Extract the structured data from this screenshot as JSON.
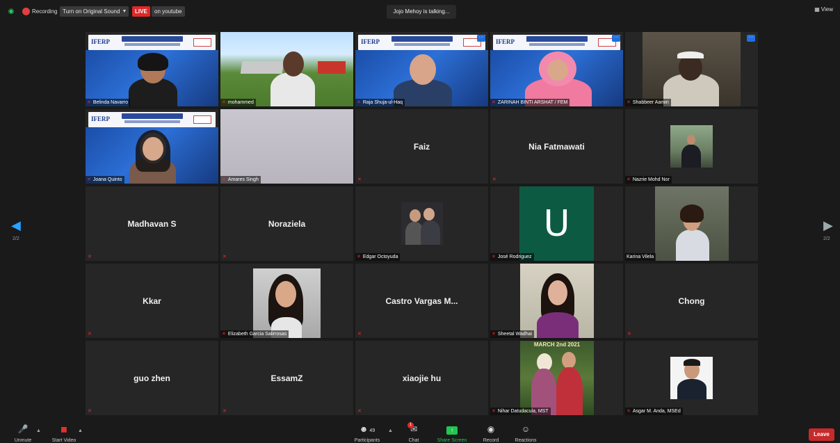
{
  "topbar": {
    "recording_label": "Recording",
    "sound_button": "Turn on Original Sound",
    "live_badge": "LIVE",
    "live_where": "on youtube",
    "talking": "Jojo Mehoy is talking...",
    "view_label": "View"
  },
  "banner": {
    "logo": "IFERP"
  },
  "tiles": [
    {
      "name": "Belinda Navarro",
      "kind": "video"
    },
    {
      "name": "mohammed",
      "kind": "video"
    },
    {
      "name": "Raja Shuja-ul-Haq",
      "kind": "video"
    },
    {
      "name": "ZARINAH BINTI ARSHAT / FEM",
      "kind": "video"
    },
    {
      "name": "Shabbeer Aamiri",
      "kind": "video"
    },
    {
      "name": "Joana Quinto",
      "kind": "video"
    },
    {
      "name": "Amares Singh",
      "kind": "video"
    },
    {
      "name": "Faiz",
      "kind": "name"
    },
    {
      "name": "Nia Fatmawati",
      "kind": "name"
    },
    {
      "name": "Nazrie Mohd Nor",
      "kind": "photo"
    },
    {
      "name": "Madhavan S",
      "kind": "name"
    },
    {
      "name": "Noraziela",
      "kind": "name"
    },
    {
      "name": "Edgar Octoyuda",
      "kind": "photo"
    },
    {
      "name": "José Rodriguez",
      "kind": "avatar",
      "avatar_letter": "U"
    },
    {
      "name": "Karina Vilela",
      "kind": "photo"
    },
    {
      "name": "Kkar",
      "kind": "name"
    },
    {
      "name": "Elizabeth Garcia Salirrosas",
      "kind": "photo"
    },
    {
      "name": "Castro Vargas M...",
      "kind": "name"
    },
    {
      "name": "Sheetal Wadhai",
      "kind": "photo"
    },
    {
      "name": "Chong",
      "kind": "name"
    },
    {
      "name": "guo zhen",
      "kind": "name"
    },
    {
      "name": "EssamZ",
      "kind": "name"
    },
    {
      "name": "xiaojie hu",
      "kind": "name"
    },
    {
      "name": "Nihar Datudacula, MST",
      "kind": "photo",
      "photo_caption": "MARCH 2nd 2021"
    },
    {
      "name": "Asgar M. Anda, MSEd",
      "kind": "photo"
    }
  ],
  "navigation": {
    "page_left": "2/2",
    "page_right": "2/2"
  },
  "controls": {
    "unmute": "Unmute",
    "start_video": "Start Video",
    "participants": "Participants",
    "participants_count": "49",
    "chat": "Chat",
    "chat_badge": "1",
    "share_screen": "Share Screen",
    "record": "Record",
    "reactions": "Reactions",
    "leave": "Leave"
  },
  "colors": {
    "accent_green": "#23c552",
    "live_red": "#e02828",
    "leave_red": "#c62a2a",
    "nav_blue": "#29a3ff"
  }
}
